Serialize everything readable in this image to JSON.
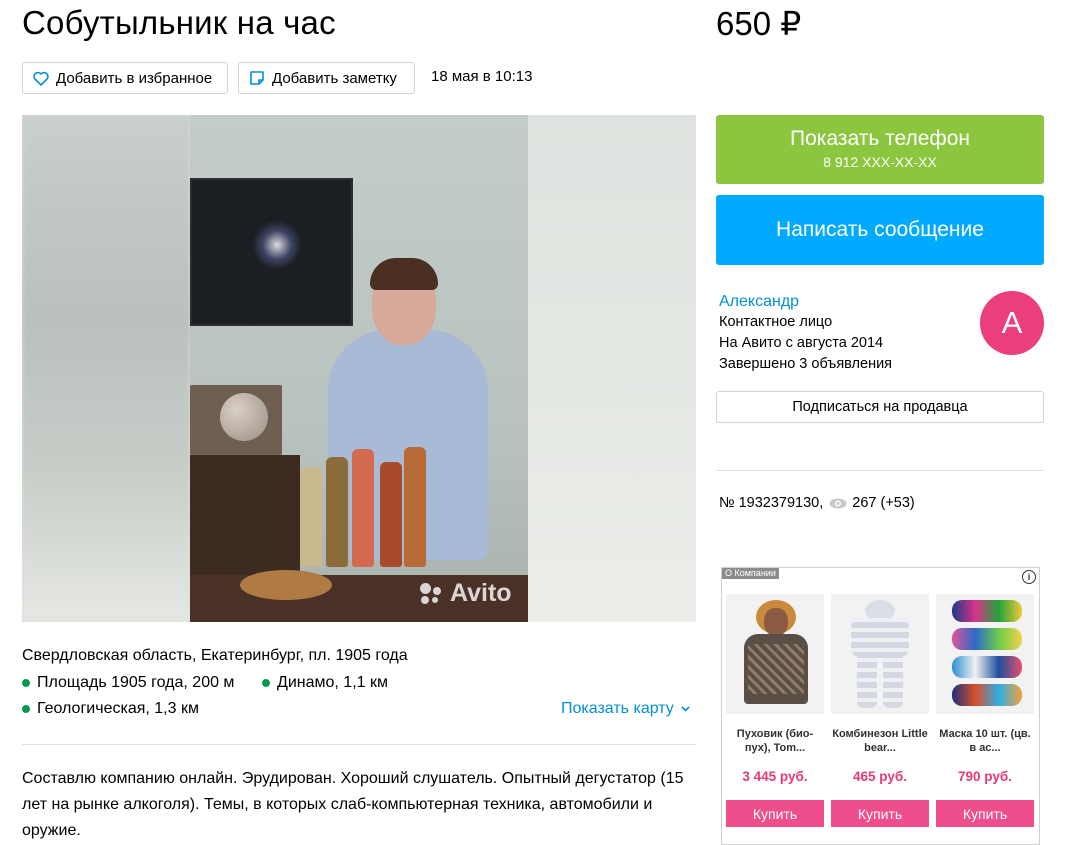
{
  "listing": {
    "title": "Собутыльник на час",
    "price": "650 ₽",
    "favorite_label": "Добавить в избранное",
    "note_label": "Добавить заметку",
    "date": "18 мая в 10:13",
    "watermark": "Avito"
  },
  "contact": {
    "show_phone_label": "Показать телефон",
    "phone_masked": "8 912 XXX-XX-XX",
    "message_label": "Написать сообщение"
  },
  "seller": {
    "name": "Александр",
    "role": "Контактное лицо",
    "since": "На Авито с августа 2014",
    "completed": "Завершено 3 объявления",
    "avatar_letter": "A",
    "subscribe_label": "Подписаться на продавца"
  },
  "stats": {
    "ad_number": "№ 1932379130,",
    "views": "267 (+53)"
  },
  "ad_block": {
    "label": "О Компании",
    "info_icon": "info-icon",
    "items": [
      {
        "title": "Пуховик (био-пух), Tom...",
        "price": "3 445 руб.",
        "buy": "Купить"
      },
      {
        "title": "Комбинезон Little bear...",
        "price": "465 руб.",
        "buy": "Купить"
      },
      {
        "title": "Маска 10 шт. (цв. в ас...",
        "price": "790 руб.",
        "buy": "Купить"
      }
    ]
  },
  "location": {
    "address": "Свердловская область, Екатеринбург, пл. 1905 года",
    "metro": [
      {
        "name": "Площадь 1905 года, 200 м"
      },
      {
        "name": "Динамо, 1,1 км"
      },
      {
        "name": "Геологическая, 1,3 км"
      }
    ],
    "map_link": "Показать карту"
  },
  "description": "Составлю компанию онлайн. Эрудирован. Хороший слушатель. Опытный дегустатор (15 лет на рынке алкоголя). Темы, в которых слаб-компьютерная техника, автомобили и оружие.",
  "colors": {
    "phone_button": "#8cc63f",
    "message_button": "#00aaff",
    "link": "#0091d9",
    "avatar": "#eb3f7d",
    "metro_dot": "#009a49",
    "ad_price": "#e5397a",
    "ad_buy": "#ee4e8b"
  }
}
